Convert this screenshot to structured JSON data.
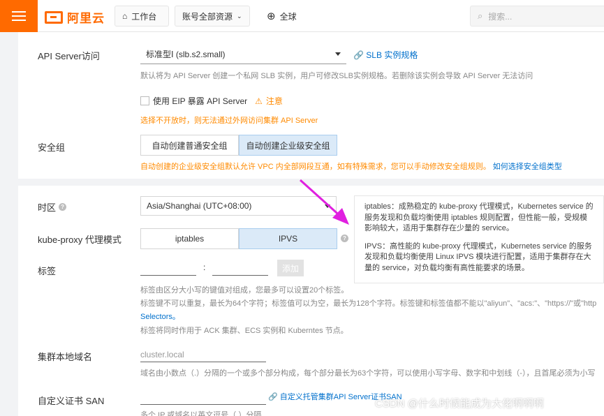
{
  "topbar": {
    "logo_text": "阿里云",
    "workbench": "工作台",
    "account_scope": "账号全部资源",
    "region": "全球",
    "search_placeholder": "搜索..."
  },
  "panel1": {
    "api_server_label": "API Server访问",
    "slb_select_value": "标准型Ⅰ (slb.s2.small)",
    "slb_spec_link": "SLB 实例规格",
    "slb_hint": "默认将为 API Server 创建一个私网 SLB 实例，用户可修改SLB实例规格。若删除该实例会导致 API Server 无法访问",
    "eip_checkbox_label": "使用 EIP 暴露 API Server",
    "eip_notice": "注意",
    "eip_warn": "选择不开放时，则无法通过外网访问集群 API Server",
    "security_group_label": "安全组",
    "sg_normal": "自动创建普通安全组",
    "sg_enterprise": "自动创建企业级安全组",
    "sg_warn": "自动创建的企业级安全组默认允许 VPC 内全部网段互通，如有特殊需求，您可以手动修改安全组规则。",
    "sg_link": "如何选择安全组类型"
  },
  "panel2": {
    "timezone_label": "时区",
    "timezone_value": "Asia/Shanghai (UTC+08:00)",
    "proxy_label": "kube-proxy 代理模式",
    "proxy_iptables": "iptables",
    "proxy_ipvs": "IPVS",
    "tags_label": "标签",
    "tag_sep": ":",
    "tag_add": "添加",
    "tag_hint1": "标签由区分大小写的键值对组成，您最多可以设置20个标签。",
    "tag_hint2": "标签键不可以重复，最长为64个字符；标签值可以为空，最长为128个字符。标签键和标签值都不能以\"aliyun\"、\"acs:\"、\"https://\"或\"http",
    "tag_selectors": "Selectors。",
    "tag_hint3": "标签将同时作用于 ACK 集群、ECS 实例和 Kuberntes 节点。",
    "domain_label": "集群本地域名",
    "domain_placeholder": "cluster.local",
    "domain_hint": "域名由小数点（.）分隔的一个或多个部分构成，每个部分最长为63个字符，可以使用小写字母、数字和中划线（-），且首尾必须为小写",
    "san_label": "自定义证书 SAN",
    "san_link": "自定义托管集群API Server证书SAN",
    "san_hint": "多个 IP 或域名以英文逗号（,）分隔",
    "tip_iptables": "iptables：成熟稳定的 kube-proxy 代理模式，Kubernetes service 的服务发现和负载均衡使用 iptables 规则配置，但性能一般，受规模影响较大，适用于集群存在少量的 service。",
    "tip_ipvs": "IPVS：高性能的 kube-proxy 代理模式，Kubernetes service 的服务发现和负载均衡使用 Linux IPVS 模块进行配置，适用于集群存在大量的 service，对负载均衡有高性能要求的场景。"
  },
  "watermark": "CSDN @什么时候能成为大佬啊啊啊",
  "colors": {
    "brand": "#ff6a00",
    "link": "#0070cc",
    "warn": "#ff8a00",
    "arrow": "#e020e0",
    "active_seg": "#dbeaf8"
  }
}
